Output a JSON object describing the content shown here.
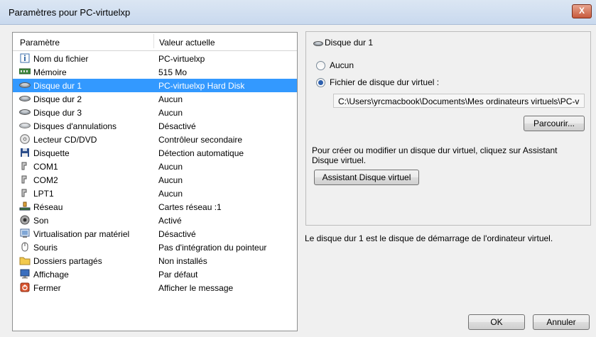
{
  "window": {
    "title": "Paramètres pour PC-virtuelxp",
    "close_label": "X"
  },
  "list": {
    "header": {
      "param": "Paramètre",
      "value": "Valeur actuelle"
    },
    "rows": [
      {
        "name": "Nom du fichier",
        "value": "PC-virtuelxp",
        "icon": "info-icon"
      },
      {
        "name": "Mémoire",
        "value": "515 Mo",
        "icon": "memory-icon"
      },
      {
        "name": "Disque dur 1",
        "value": "PC-virtuelxp Hard Disk",
        "icon": "hard-disk-icon",
        "selected": true
      },
      {
        "name": "Disque dur 2",
        "value": "Aucun",
        "icon": "hard-disk-icon"
      },
      {
        "name": "Disque dur 3",
        "value": "Aucun",
        "icon": "hard-disk-icon"
      },
      {
        "name": "Disques d'annulations",
        "value": "Désactivé",
        "icon": "undo-disk-icon"
      },
      {
        "name": "Lecteur CD/DVD",
        "value": "Contrôleur secondaire",
        "icon": "cd-dvd-icon"
      },
      {
        "name": "Disquette",
        "value": "Détection automatique",
        "icon": "floppy-icon"
      },
      {
        "name": "COM1",
        "value": "Aucun",
        "icon": "port-icon"
      },
      {
        "name": "COM2",
        "value": "Aucun",
        "icon": "port-icon"
      },
      {
        "name": "LPT1",
        "value": "Aucun",
        "icon": "port-icon"
      },
      {
        "name": "Réseau",
        "value": "Cartes réseau :1",
        "icon": "network-icon"
      },
      {
        "name": "Son",
        "value": "Activé",
        "icon": "sound-icon"
      },
      {
        "name": "Virtualisation par matériel",
        "value": "Désactivé",
        "icon": "hardware-virtualization-icon"
      },
      {
        "name": "Souris",
        "value": "Pas d'intégration du pointeur",
        "icon": "mouse-icon"
      },
      {
        "name": "Dossiers partagés",
        "value": "Non installés",
        "icon": "folder-icon"
      },
      {
        "name": "Affichage",
        "value": "Par défaut",
        "icon": "display-icon"
      },
      {
        "name": "Fermer",
        "value": "Afficher le message",
        "icon": "close-power-icon"
      }
    ]
  },
  "detail": {
    "title": "Disque dur 1",
    "option_none": "Aucun",
    "option_vhd": "Fichier de disque dur virtuel :",
    "selected_option": "vhd",
    "path_value": "C:\\Users\\yrcmacbook\\Documents\\Mes ordinateurs virtuels\\PC-v",
    "browse_label": "Parcourir...",
    "description": "Pour créer ou modifier un disque dur virtuel, cliquez sur Assistant Disque virtuel.",
    "wizard_label": "Assistant Disque virtuel"
  },
  "boot_description": "Le disque dur 1 est le disque de démarrage de l'ordinateur virtuel.",
  "buttons": {
    "ok": "OK",
    "cancel": "Annuler"
  },
  "colors": {
    "selection": "#3399ff",
    "close": "#c75a3c"
  }
}
